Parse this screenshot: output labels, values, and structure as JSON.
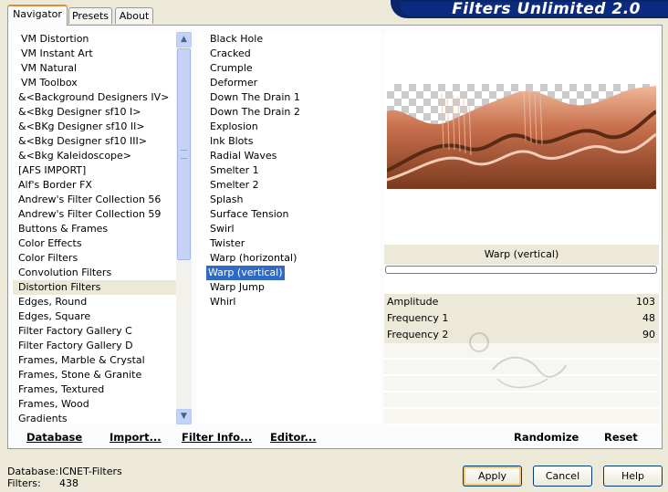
{
  "app": {
    "title": "Filters Unlimited 2.0"
  },
  "tabs": [
    {
      "label": "Navigator",
      "active": true
    },
    {
      "label": "Presets",
      "active": false
    },
    {
      "label": "About",
      "active": false
    }
  ],
  "categories": {
    "items": [
      "VM Distortion",
      "VM Instant Art",
      "VM Natural",
      "VM Toolbox",
      "&<Background Designers IV>",
      "&<Bkg Designer sf10 I>",
      "&<BKg Designer sf10 II>",
      "&<Bkg Designer sf10 III>",
      "&<Bkg Kaleidoscope>",
      "[AFS IMPORT]",
      "Alf's Border FX",
      "Andrew's Filter Collection 56",
      "Andrew's Filter Collection 59",
      "Buttons & Frames",
      "Color Effects",
      "Color Filters",
      "Convolution Filters",
      "Distortion Filters",
      "Edges, Round",
      "Edges, Square",
      "Filter Factory Gallery C",
      "Filter Factory Gallery D",
      "Frames, Marble & Crystal",
      "Frames, Stone & Granite",
      "Frames, Textured",
      "Frames, Wood",
      "Gradients"
    ],
    "selected": "Distortion Filters"
  },
  "filters": {
    "items": [
      "Black Hole",
      "Cracked",
      "Crumple",
      "Deformer",
      "Down The Drain 1",
      "Down The Drain 2",
      "Explosion",
      "Ink Blots",
      "Radial Waves",
      "Smelter 1",
      "Smelter 2",
      "Splash",
      "Surface Tension",
      "Swirl",
      "Twister",
      "Warp (horizontal)",
      "Warp (vertical)",
      "Warp Jump",
      "Whirl"
    ],
    "selected": "Warp (vertical)"
  },
  "toolbar": {
    "database": "Database",
    "import": "Import...",
    "filter_info": "Filter Info...",
    "editor": "Editor...",
    "randomize": "Randomize",
    "reset": "Reset"
  },
  "preview": {
    "filter_name": "Warp (vertical)",
    "progress_fraction": 0
  },
  "parameters": [
    {
      "label": "Amplitude",
      "value": "103"
    },
    {
      "label": "Frequency 1",
      "value": "48"
    },
    {
      "label": "Frequency 2",
      "value": "90"
    }
  ],
  "footer": {
    "database_label": "Database:",
    "database_value": "ICNET-Filters",
    "filters_label": "Filters:",
    "filters_value": "438",
    "apply": "Apply",
    "cancel": "Cancel",
    "help": "Help"
  },
  "colors": {
    "accent": "#316ac5",
    "banner": "#0a246a",
    "preview_copper": "#c8704d"
  }
}
